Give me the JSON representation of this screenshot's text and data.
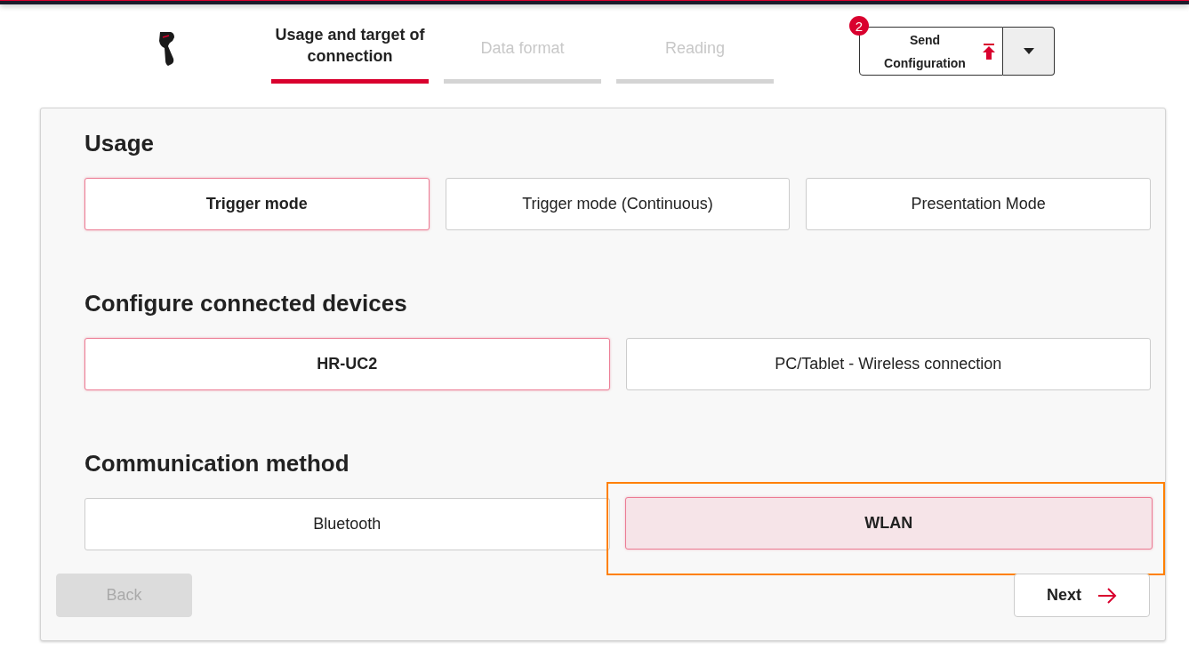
{
  "header": {
    "badge": "2",
    "send_button": "Send Configuration"
  },
  "steps": [
    {
      "label": "Usage and target of connection",
      "selected": true
    },
    {
      "label": "Data format",
      "selected": false
    },
    {
      "label": "Reading",
      "selected": false
    }
  ],
  "sections": [
    {
      "title": "Usage",
      "options": [
        {
          "label": "Trigger mode",
          "selected": true,
          "focused": false
        },
        {
          "label": "Trigger mode (Continuous)",
          "selected": false,
          "focused": false
        },
        {
          "label": "Presentation Mode",
          "selected": false,
          "focused": false
        }
      ]
    },
    {
      "title": "Configure connected devices",
      "options": [
        {
          "label": "HR-UC2",
          "selected": true,
          "focused": false
        },
        {
          "label": "PC/Tablet - Wireless connection",
          "selected": false,
          "focused": false
        }
      ]
    },
    {
      "title": "Communication method",
      "options": [
        {
          "label": "Bluetooth",
          "selected": false,
          "focused": false
        },
        {
          "label": "WLAN",
          "selected": true,
          "focused": true
        }
      ]
    }
  ],
  "back": {
    "label": "Back",
    "disabled": true
  },
  "next": {
    "label": "Next",
    "disabled": false
  }
}
